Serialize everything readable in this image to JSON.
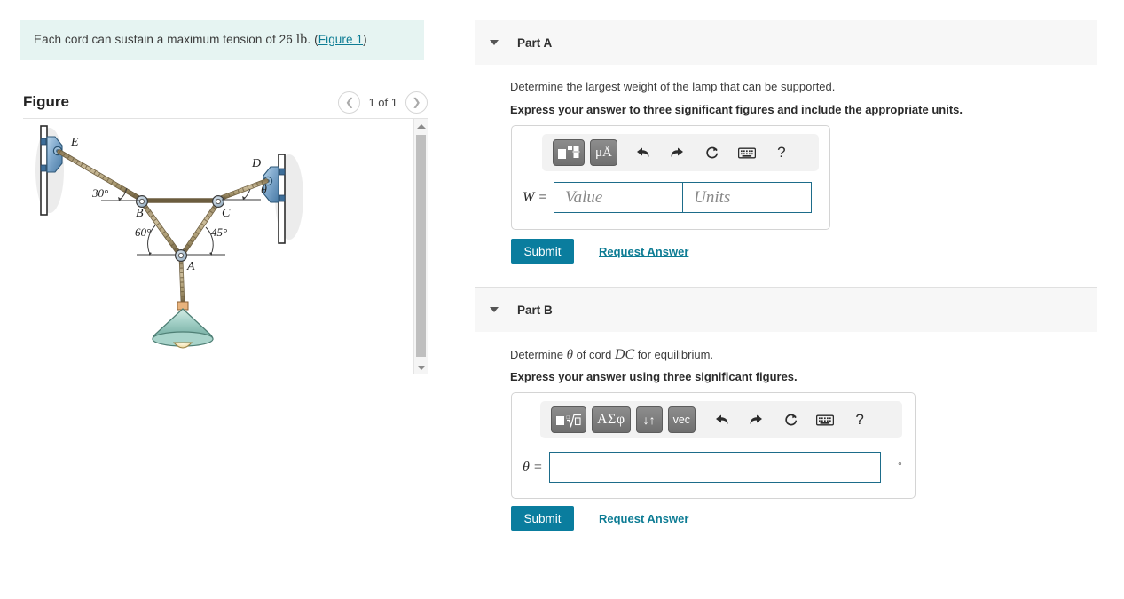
{
  "problem": {
    "text_before": "Each cord can sustain a maximum tension of 26",
    "unit": "lb",
    "separator": ".",
    "paren_open": "(",
    "figure_link": "Figure 1",
    "paren_close": ")"
  },
  "figure": {
    "title": "Figure",
    "counter": "1 of 1",
    "prev_icon": "chevron-left-icon",
    "next_icon": "chevron-right-icon",
    "labels": {
      "E": "E",
      "D": "D",
      "B": "B",
      "C": "C",
      "A": "A",
      "theta": "θ",
      "angle_30": "30°",
      "angle_60": "60°",
      "angle_45": "45°"
    },
    "colors": {
      "cord": "#a89878",
      "cord_dark": "#6b5c3e",
      "bracket": "#7fa8cc",
      "bracket_dark": "#3d6e99",
      "lamp_shade": "#9fcfc6",
      "lamp_shade_dark": "#5f9b90",
      "bulb": "#f3e2b0",
      "wall": "#ffffff"
    },
    "scrollbar": {
      "up_icon": "triangle-up-icon",
      "down_icon": "triangle-down-icon"
    }
  },
  "parts": [
    {
      "id": "a",
      "label": "Part A",
      "caret_icon": "caret-down-icon",
      "prompt": "Determine the largest weight of the lamp that can be supported.",
      "instruction": "Express your answer to three significant figures and include the appropriate units.",
      "toolbar": [
        {
          "name": "math-template-button",
          "glyph": "template",
          "kind": "template"
        },
        {
          "name": "units-button",
          "glyph": "μÅ",
          "kind": "template"
        },
        {
          "name": "undo-button",
          "glyph": "↶",
          "kind": "plain"
        },
        {
          "name": "redo-button",
          "glyph": "↷",
          "kind": "plain"
        },
        {
          "name": "reset-button",
          "glyph": "⟳",
          "kind": "plain"
        },
        {
          "name": "keyboard-button",
          "glyph": "⌨",
          "kind": "plain"
        },
        {
          "name": "help-button",
          "glyph": "?",
          "kind": "plain"
        }
      ],
      "variable": "W =",
      "value_placeholder": "Value",
      "units_placeholder": "Units",
      "value": "",
      "units": "",
      "submit_label": "Submit",
      "request_label": "Request Answer"
    },
    {
      "id": "b",
      "label": "Part B",
      "caret_icon": "caret-down-icon",
      "prompt_before": "Determine ",
      "prompt_theta": "θ",
      "prompt_middle": " of cord ",
      "prompt_cord": "DC",
      "prompt_after": " for equilibrium.",
      "instruction": "Express your answer using three significant figures.",
      "toolbar": [
        {
          "name": "nth-root-template-button",
          "glyph": "root",
          "kind": "template"
        },
        {
          "name": "greek-letters-button",
          "glyph": "ΑΣφ",
          "kind": "greek"
        },
        {
          "name": "subscript-superscript-button",
          "glyph": "↓↑",
          "kind": "updown"
        },
        {
          "name": "vector-button",
          "glyph": "vec",
          "kind": "vec"
        },
        {
          "name": "undo-button",
          "glyph": "↶",
          "kind": "plain"
        },
        {
          "name": "redo-button",
          "glyph": "↷",
          "kind": "plain"
        },
        {
          "name": "reset-button",
          "glyph": "⟳",
          "kind": "plain"
        },
        {
          "name": "keyboard-button",
          "glyph": "⌨",
          "kind": "plain"
        },
        {
          "name": "help-button",
          "glyph": "?",
          "kind": "plain"
        }
      ],
      "variable": "θ =",
      "value": "",
      "degree_unit": "°",
      "submit_label": "Submit",
      "request_label": "Request Answer"
    }
  ],
  "colors": {
    "accent": "#0a7d9e",
    "link": "#0d7c94",
    "banner_bg": "#e6f4f2",
    "header_bg": "#f7f7f7",
    "input_border": "#1d6c8a"
  }
}
